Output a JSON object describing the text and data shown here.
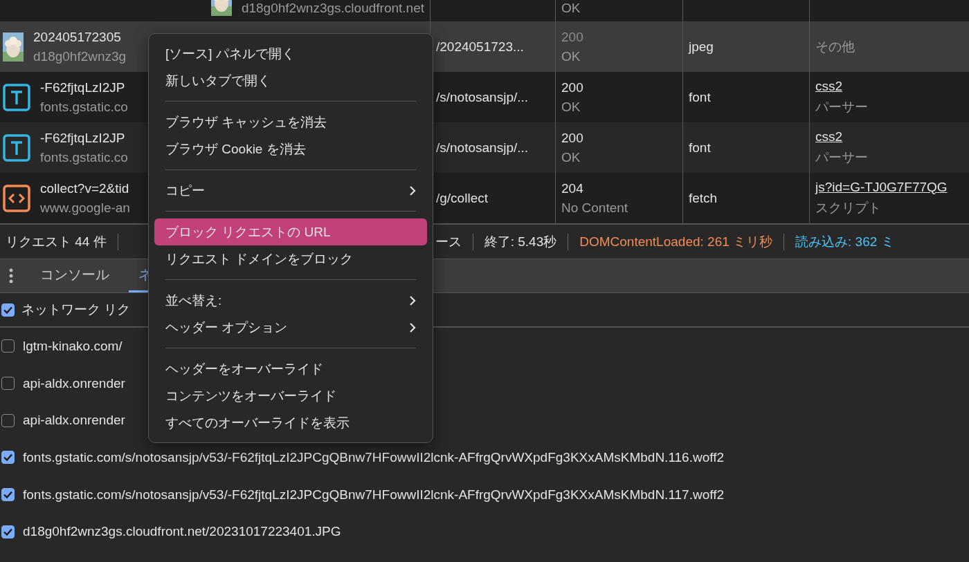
{
  "requests": [
    {
      "selected": false,
      "domain": "d18g0hf2wnz3gs.cloudfront.net",
      "status_text": "OK"
    },
    {
      "selected": true,
      "name": "202405172305",
      "domain": "d18g0hf2wnz3g",
      "path": "/2024051723...",
      "status": "200",
      "status_text": "OK",
      "type": "jpeg",
      "initiator_sub": "その他"
    },
    {
      "kind": "font",
      "selected": false,
      "name": "-F62fjtqLzI2JP",
      "domain": "fonts.gstatic.co",
      "path": "/s/notosansjp/...",
      "status": "200",
      "status_text": "OK",
      "type": "font",
      "initiator": "css2",
      "initiator_sub": "パーサー"
    },
    {
      "kind": "font",
      "selected": false,
      "name": "-F62fjtqLzI2JP",
      "domain": "fonts.gstatic.co",
      "path": "/s/notosansjp/...",
      "status": "200",
      "status_text": "OK",
      "type": "font",
      "initiator": "css2",
      "initiator_sub": "パーサー"
    },
    {
      "kind": "script",
      "selected": false,
      "name": "collect?v=2&tid",
      "domain": "www.google-an",
      "path": "/g/collect",
      "status": "204",
      "status_text": "No Content",
      "type": "fetch",
      "initiator": "js?id=G-TJ0G7F77QG",
      "initiator_sub": "スクリプト"
    }
  ],
  "summary": [
    {
      "kind": "plain",
      "text": "リクエスト 44 件"
    },
    {
      "kind": "plain",
      "text": "ース"
    },
    {
      "kind": "plain",
      "text": "終了: 5.43秒"
    },
    {
      "kind": "dom",
      "text": "DOMContentLoaded: 261 ミリ秒"
    },
    {
      "kind": "load",
      "text": "読み込み: 362 ミ"
    }
  ],
  "drawer_tabs": [
    {
      "label": "コンソール",
      "selected": false
    },
    {
      "label": "ネ",
      "selected": true
    }
  ],
  "blocking": {
    "enable_label": "ネットワーク リク",
    "enabled": true
  },
  "patterns": [
    {
      "text": "lgtm-kinako.com/",
      "checked": false
    },
    {
      "text": "api-aldx.onrender",
      "checked": false
    },
    {
      "text": "api-aldx.onrender",
      "checked": false
    },
    {
      "text": "fonts.gstatic.com/s/notosansjp/v53/-F62fjtqLzI2JPCgQBnw7HFowwII2lcnk-AFfrgQrvWXpdFg3KXxAMsKMbdN.116.woff2",
      "checked": true
    },
    {
      "text": "fonts.gstatic.com/s/notosansjp/v53/-F62fjtqLzI2JPCgQBnw7HFowwII2lcnk-AFfrgQrvWXpdFg3KXxAMsKMbdN.117.woff2",
      "checked": true
    },
    {
      "text": "d18g0hf2wnz3gs.cloudfront.net/20231017223401.JPG",
      "checked": true
    }
  ],
  "context_menu": [
    {
      "kind": "item",
      "label": "[ソース] パネルで開く",
      "submenu": false,
      "selected": false
    },
    {
      "kind": "item",
      "label": "新しいタブで開く",
      "submenu": false,
      "selected": false
    },
    {
      "kind": "separator"
    },
    {
      "kind": "item",
      "label": "ブラウザ キャッシュを消去",
      "submenu": false,
      "selected": false
    },
    {
      "kind": "item",
      "label": "ブラウザ Cookie を消去",
      "submenu": false,
      "selected": false
    },
    {
      "kind": "separator"
    },
    {
      "kind": "item",
      "label": "コピー",
      "submenu": true,
      "selected": false
    },
    {
      "kind": "separator"
    },
    {
      "kind": "item",
      "label": "ブロック リクエストの URL",
      "submenu": false,
      "selected": true
    },
    {
      "kind": "item",
      "label": "リクエスト ドメインをブロック",
      "submenu": false,
      "selected": false
    },
    {
      "kind": "separator"
    },
    {
      "kind": "item",
      "label": "並べ替え:",
      "submenu": true,
      "selected": false
    },
    {
      "kind": "item",
      "label": "ヘッダー オプション",
      "submenu": true,
      "selected": false
    },
    {
      "kind": "separator"
    },
    {
      "kind": "item",
      "label": "ヘッダーをオーバーライド",
      "submenu": false,
      "selected": false
    },
    {
      "kind": "item",
      "label": "コンテンツをオーバーライド",
      "submenu": false,
      "selected": false
    },
    {
      "kind": "item",
      "label": "すべてのオーバーライドを表示",
      "submenu": false,
      "selected": false
    }
  ]
}
